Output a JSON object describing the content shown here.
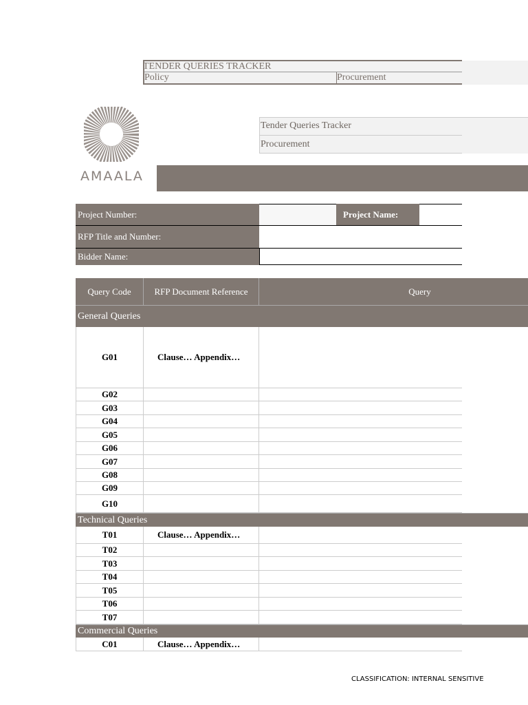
{
  "header": {
    "title": "TENDER QUERIES TRACKER",
    "policy_label": "Policy",
    "policy_value": "Procurement"
  },
  "info_box": {
    "line1": "Tender Queries Tracker",
    "line2": "Procurement"
  },
  "logo": {
    "text": "AMAALA"
  },
  "project": {
    "number_label": "Project Number:",
    "number_value": "",
    "name_label": "Project Name:",
    "name_value": "",
    "rfp_label": "RFP Title and Number:",
    "rfp_value": "",
    "bidder_label": "Bidder Name:",
    "bidder_value": ""
  },
  "table": {
    "columns": [
      "Query Code",
      "RFP Document Reference",
      "Query"
    ],
    "sections": [
      {
        "title": "General Queries",
        "rows": [
          {
            "code": "G01",
            "ref": "Clause… Appendix…"
          },
          {
            "code": "G02",
            "ref": ""
          },
          {
            "code": "G03",
            "ref": ""
          },
          {
            "code": "G04",
            "ref": ""
          },
          {
            "code": "G05",
            "ref": ""
          },
          {
            "code": "G06",
            "ref": ""
          },
          {
            "code": "G07",
            "ref": ""
          },
          {
            "code": "G08",
            "ref": ""
          },
          {
            "code": "G09",
            "ref": ""
          },
          {
            "code": "G10",
            "ref": ""
          }
        ]
      },
      {
        "title": "Technical Queries",
        "rows": [
          {
            "code": "T01",
            "ref": "Clause… Appendix…"
          },
          {
            "code": "T02",
            "ref": ""
          },
          {
            "code": "T03",
            "ref": ""
          },
          {
            "code": "T04",
            "ref": ""
          },
          {
            "code": "T05",
            "ref": ""
          },
          {
            "code": "T06",
            "ref": ""
          },
          {
            "code": "T07",
            "ref": ""
          }
        ]
      },
      {
        "title": "Commercial Queries",
        "rows": [
          {
            "code": "C01",
            "ref": "Clause… Appendix…"
          }
        ]
      }
    ]
  },
  "footer": {
    "classification": "CLASSIFICATION: INTERNAL SENSITIVE"
  }
}
